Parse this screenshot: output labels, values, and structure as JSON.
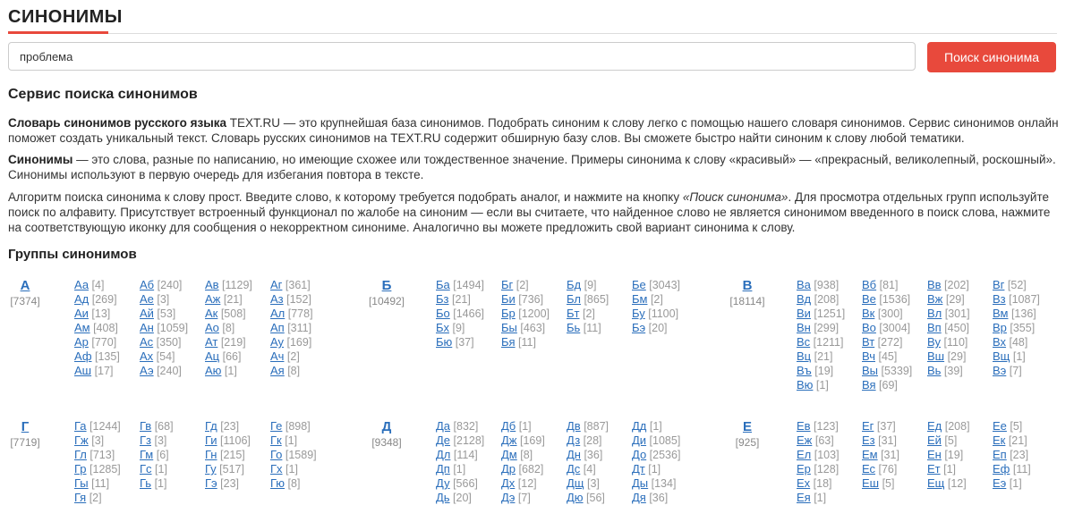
{
  "header": {
    "title": "СИНОНИМЫ"
  },
  "search": {
    "value": "проблема",
    "button_label": "Поиск синонима"
  },
  "intro": {
    "heading": "Сервис поиска синонимов",
    "p1_bold": "Словарь синонимов русского языка",
    "p1_text": " TEXT.RU — это крупнейшая база синонимов. Подобрать синоним к слову легко с помощью нашего словаря синонимов. Сервис синонимов онлайн поможет создать уникальный текст. Словарь русских синонимов на TEXT.RU содержит обширную базу слов. Вы сможете быстро найти синоним к слову любой тематики.",
    "p2_bold": "Синонимы",
    "p2_text": " — это слова, разные по написанию, но имеющие схожее или тождественное значение. Примеры синонима к слову «красивый» — «прекрасный, великолепный, роскошный». Синонимы используют в первую очередь для избегания повтора в тексте.",
    "p3_text_a": "Алгоритм поиска синонима к слову прост. Введите слово, к которому требуется подобрать аналог, и нажмите на кнопку ",
    "p3_italic": "«Поиск синонима»",
    "p3_text_b": ". Для просмотра отдельных групп используйте поиск по алфавиту. Присутствует встроенный функционал по жалобе на синоним — если вы считаете, что найденное слово не является синонимом введенного в поиск слова, нажмите на соответствующую иконку для сообщения о некорректном синониме. Аналогично вы можете предложить свой вариант синонима к слову."
  },
  "groups_heading": "Группы синонимов",
  "groups": [
    {
      "letter": "А",
      "count": "[7374]",
      "cols": [
        [
          [
            "Аа",
            "[4]"
          ],
          [
            "Ад",
            "[269]"
          ],
          [
            "Аи",
            "[13]"
          ],
          [
            "Ам",
            "[408]"
          ],
          [
            "Ар",
            "[770]"
          ],
          [
            "Аф",
            "[135]"
          ],
          [
            "Аш",
            "[17]"
          ]
        ],
        [
          [
            "Аб",
            "[240]"
          ],
          [
            "Ае",
            "[3]"
          ],
          [
            "Ай",
            "[53]"
          ],
          [
            "Ан",
            "[1059]"
          ],
          [
            "Ас",
            "[350]"
          ],
          [
            "Ах",
            "[54]"
          ],
          [
            "Аэ",
            "[240]"
          ]
        ],
        [
          [
            "Ав",
            "[1129]"
          ],
          [
            "Аж",
            "[21]"
          ],
          [
            "Ак",
            "[508]"
          ],
          [
            "Ао",
            "[8]"
          ],
          [
            "Ат",
            "[219]"
          ],
          [
            "Ац",
            "[66]"
          ],
          [
            "Аю",
            "[1]"
          ]
        ],
        [
          [
            "Аг",
            "[361]"
          ],
          [
            "Аз",
            "[152]"
          ],
          [
            "Ал",
            "[778]"
          ],
          [
            "Ап",
            "[311]"
          ],
          [
            "Ау",
            "[169]"
          ],
          [
            "Ач",
            "[2]"
          ],
          [
            "Ая",
            "[8]"
          ]
        ]
      ]
    },
    {
      "letter": "Б",
      "count": "[10492]",
      "cols": [
        [
          [
            "Ба",
            "[1494]"
          ],
          [
            "Бз",
            "[21]"
          ],
          [
            "Бо",
            "[1466]"
          ],
          [
            "Бх",
            "[9]"
          ],
          [
            "Бю",
            "[37]"
          ]
        ],
        [
          [
            "Бг",
            "[2]"
          ],
          [
            "Би",
            "[736]"
          ],
          [
            "Бр",
            "[1200]"
          ],
          [
            "Бы",
            "[463]"
          ],
          [
            "Бя",
            "[11]"
          ]
        ],
        [
          [
            "Бд",
            "[9]"
          ],
          [
            "Бл",
            "[865]"
          ],
          [
            "Бт",
            "[2]"
          ],
          [
            "Бь",
            "[11]"
          ]
        ],
        [
          [
            "Бе",
            "[3043]"
          ],
          [
            "Бм",
            "[2]"
          ],
          [
            "Бу",
            "[1100]"
          ],
          [
            "Бэ",
            "[20]"
          ]
        ]
      ]
    },
    {
      "letter": "В",
      "count": "[18114]",
      "cols": [
        [
          [
            "Ва",
            "[938]"
          ],
          [
            "Вд",
            "[208]"
          ],
          [
            "Ви",
            "[1251]"
          ],
          [
            "Вн",
            "[299]"
          ],
          [
            "Вс",
            "[1211]"
          ],
          [
            "Вц",
            "[21]"
          ],
          [
            "Въ",
            "[19]"
          ],
          [
            "Вю",
            "[1]"
          ]
        ],
        [
          [
            "Вб",
            "[81]"
          ],
          [
            "Ве",
            "[1536]"
          ],
          [
            "Вк",
            "[300]"
          ],
          [
            "Во",
            "[3004]"
          ],
          [
            "Вт",
            "[272]"
          ],
          [
            "Вч",
            "[45]"
          ],
          [
            "Вы",
            "[5339]"
          ],
          [
            "Вя",
            "[69]"
          ]
        ],
        [
          [
            "Вв",
            "[202]"
          ],
          [
            "Вж",
            "[29]"
          ],
          [
            "Вл",
            "[301]"
          ],
          [
            "Вп",
            "[450]"
          ],
          [
            "Ву",
            "[110]"
          ],
          [
            "Вш",
            "[29]"
          ],
          [
            "Вь",
            "[39]"
          ]
        ],
        [
          [
            "Вг",
            "[52]"
          ],
          [
            "Вз",
            "[1087]"
          ],
          [
            "Вм",
            "[136]"
          ],
          [
            "Вр",
            "[355]"
          ],
          [
            "Вх",
            "[48]"
          ],
          [
            "Вщ",
            "[1]"
          ],
          [
            "Вэ",
            "[7]"
          ]
        ]
      ]
    },
    {
      "letter": "Г",
      "count": "[7719]",
      "cols": [
        [
          [
            "Га",
            "[1244]"
          ],
          [
            "Гж",
            "[3]"
          ],
          [
            "Гл",
            "[713]"
          ],
          [
            "Гр",
            "[1285]"
          ],
          [
            "Гы",
            "[11]"
          ],
          [
            "Гя",
            "[2]"
          ]
        ],
        [
          [
            "Гв",
            "[68]"
          ],
          [
            "Гз",
            "[3]"
          ],
          [
            "Гм",
            "[6]"
          ],
          [
            "Гс",
            "[1]"
          ],
          [
            "Гь",
            "[1]"
          ]
        ],
        [
          [
            "Гд",
            "[23]"
          ],
          [
            "Ги",
            "[1106]"
          ],
          [
            "Гн",
            "[215]"
          ],
          [
            "Гу",
            "[517]"
          ],
          [
            "Гэ",
            "[23]"
          ]
        ],
        [
          [
            "Ге",
            "[898]"
          ],
          [
            "Гк",
            "[1]"
          ],
          [
            "Го",
            "[1589]"
          ],
          [
            "Гх",
            "[1]"
          ],
          [
            "Гю",
            "[8]"
          ]
        ]
      ]
    },
    {
      "letter": "Д",
      "count": "[9348]",
      "cols": [
        [
          [
            "Да",
            "[832]"
          ],
          [
            "Де",
            "[2128]"
          ],
          [
            "Дл",
            "[114]"
          ],
          [
            "Дп",
            "[1]"
          ],
          [
            "Ду",
            "[566]"
          ],
          [
            "Дь",
            "[20]"
          ]
        ],
        [
          [
            "Дб",
            "[1]"
          ],
          [
            "Дж",
            "[169]"
          ],
          [
            "Дм",
            "[8]"
          ],
          [
            "Др",
            "[682]"
          ],
          [
            "Дх",
            "[12]"
          ],
          [
            "Дэ",
            "[7]"
          ]
        ],
        [
          [
            "Дв",
            "[887]"
          ],
          [
            "Дз",
            "[28]"
          ],
          [
            "Дн",
            "[36]"
          ],
          [
            "Дс",
            "[4]"
          ],
          [
            "Дщ",
            "[3]"
          ],
          [
            "Дю",
            "[56]"
          ]
        ],
        [
          [
            "Дд",
            "[1]"
          ],
          [
            "Ди",
            "[1085]"
          ],
          [
            "До",
            "[2536]"
          ],
          [
            "Дт",
            "[1]"
          ],
          [
            "Ды",
            "[134]"
          ],
          [
            "Дя",
            "[36]"
          ]
        ]
      ]
    },
    {
      "letter": "Е",
      "count": "[925]",
      "cols": [
        [
          [
            "Ев",
            "[123]"
          ],
          [
            "Еж",
            "[63]"
          ],
          [
            "Ел",
            "[103]"
          ],
          [
            "Ер",
            "[128]"
          ],
          [
            "Ех",
            "[18]"
          ],
          [
            "Ея",
            "[1]"
          ]
        ],
        [
          [
            "Ег",
            "[37]"
          ],
          [
            "Ез",
            "[31]"
          ],
          [
            "Ем",
            "[31]"
          ],
          [
            "Ес",
            "[76]"
          ],
          [
            "Еш",
            "[5]"
          ]
        ],
        [
          [
            "Ед",
            "[208]"
          ],
          [
            "Ей",
            "[5]"
          ],
          [
            "Ен",
            "[19]"
          ],
          [
            "Ет",
            "[1]"
          ],
          [
            "Ещ",
            "[12]"
          ]
        ],
        [
          [
            "Ее",
            "[5]"
          ],
          [
            "Ек",
            "[21]"
          ],
          [
            "Еп",
            "[23]"
          ],
          [
            "Еф",
            "[11]"
          ],
          [
            "Еэ",
            "[1]"
          ]
        ]
      ]
    }
  ]
}
